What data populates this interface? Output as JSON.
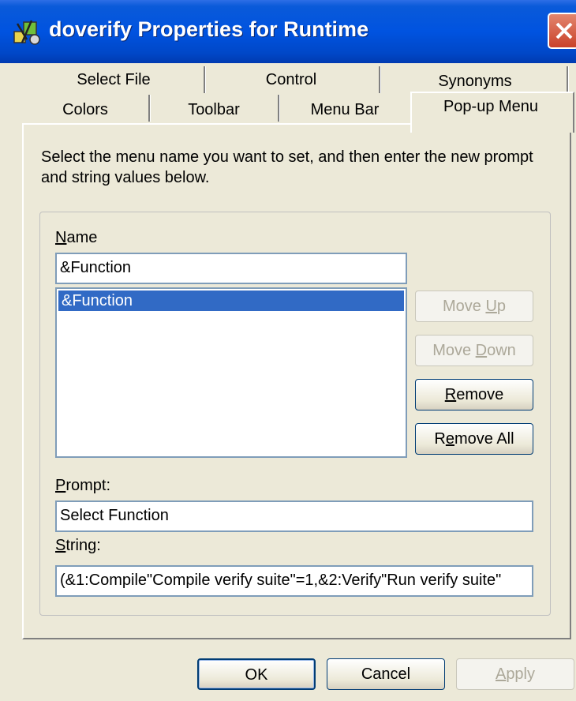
{
  "window": {
    "title": "doverify Properties for Runtime"
  },
  "tabs": {
    "row_back": [
      "Select File",
      "Control",
      "Synonyms"
    ],
    "row_front": [
      "Colors",
      "Toolbar",
      "Menu Bar"
    ],
    "active": "Pop-up Menu"
  },
  "instruction": "Select the menu name you want to set, and then enter the new prompt and string values below.",
  "name": {
    "label_u": "N",
    "label_rest": "ame",
    "value": "&Function",
    "list_items": [
      "&Function"
    ]
  },
  "buttons": {
    "move_up": {
      "pre": "Move ",
      "u": "U",
      "post": "p"
    },
    "move_down": {
      "pre": "Move ",
      "u": "D",
      "post": "own"
    },
    "remove": {
      "pre": "",
      "u": "R",
      "post": "emove"
    },
    "remove_all": {
      "pre": "R",
      "u": "e",
      "post": "move All"
    }
  },
  "prompt": {
    "label_u": "P",
    "label_rest": "rompt:",
    "value": "Select Function"
  },
  "string": {
    "label_u": "S",
    "label_rest": "tring:",
    "value": "(&1:Compile\"Compile verify suite\"=1,&2:Verify\"Run verify suite\""
  },
  "footer": {
    "ok": "OK",
    "cancel": "Cancel",
    "apply_u": "A",
    "apply_rest": "pply"
  },
  "icons": [
    "app-icon",
    "close-icon"
  ],
  "colors": {
    "titlebar": "#0053e0",
    "selection": "#316ac5",
    "close": "#c9412a",
    "face": "#ece9d8"
  }
}
